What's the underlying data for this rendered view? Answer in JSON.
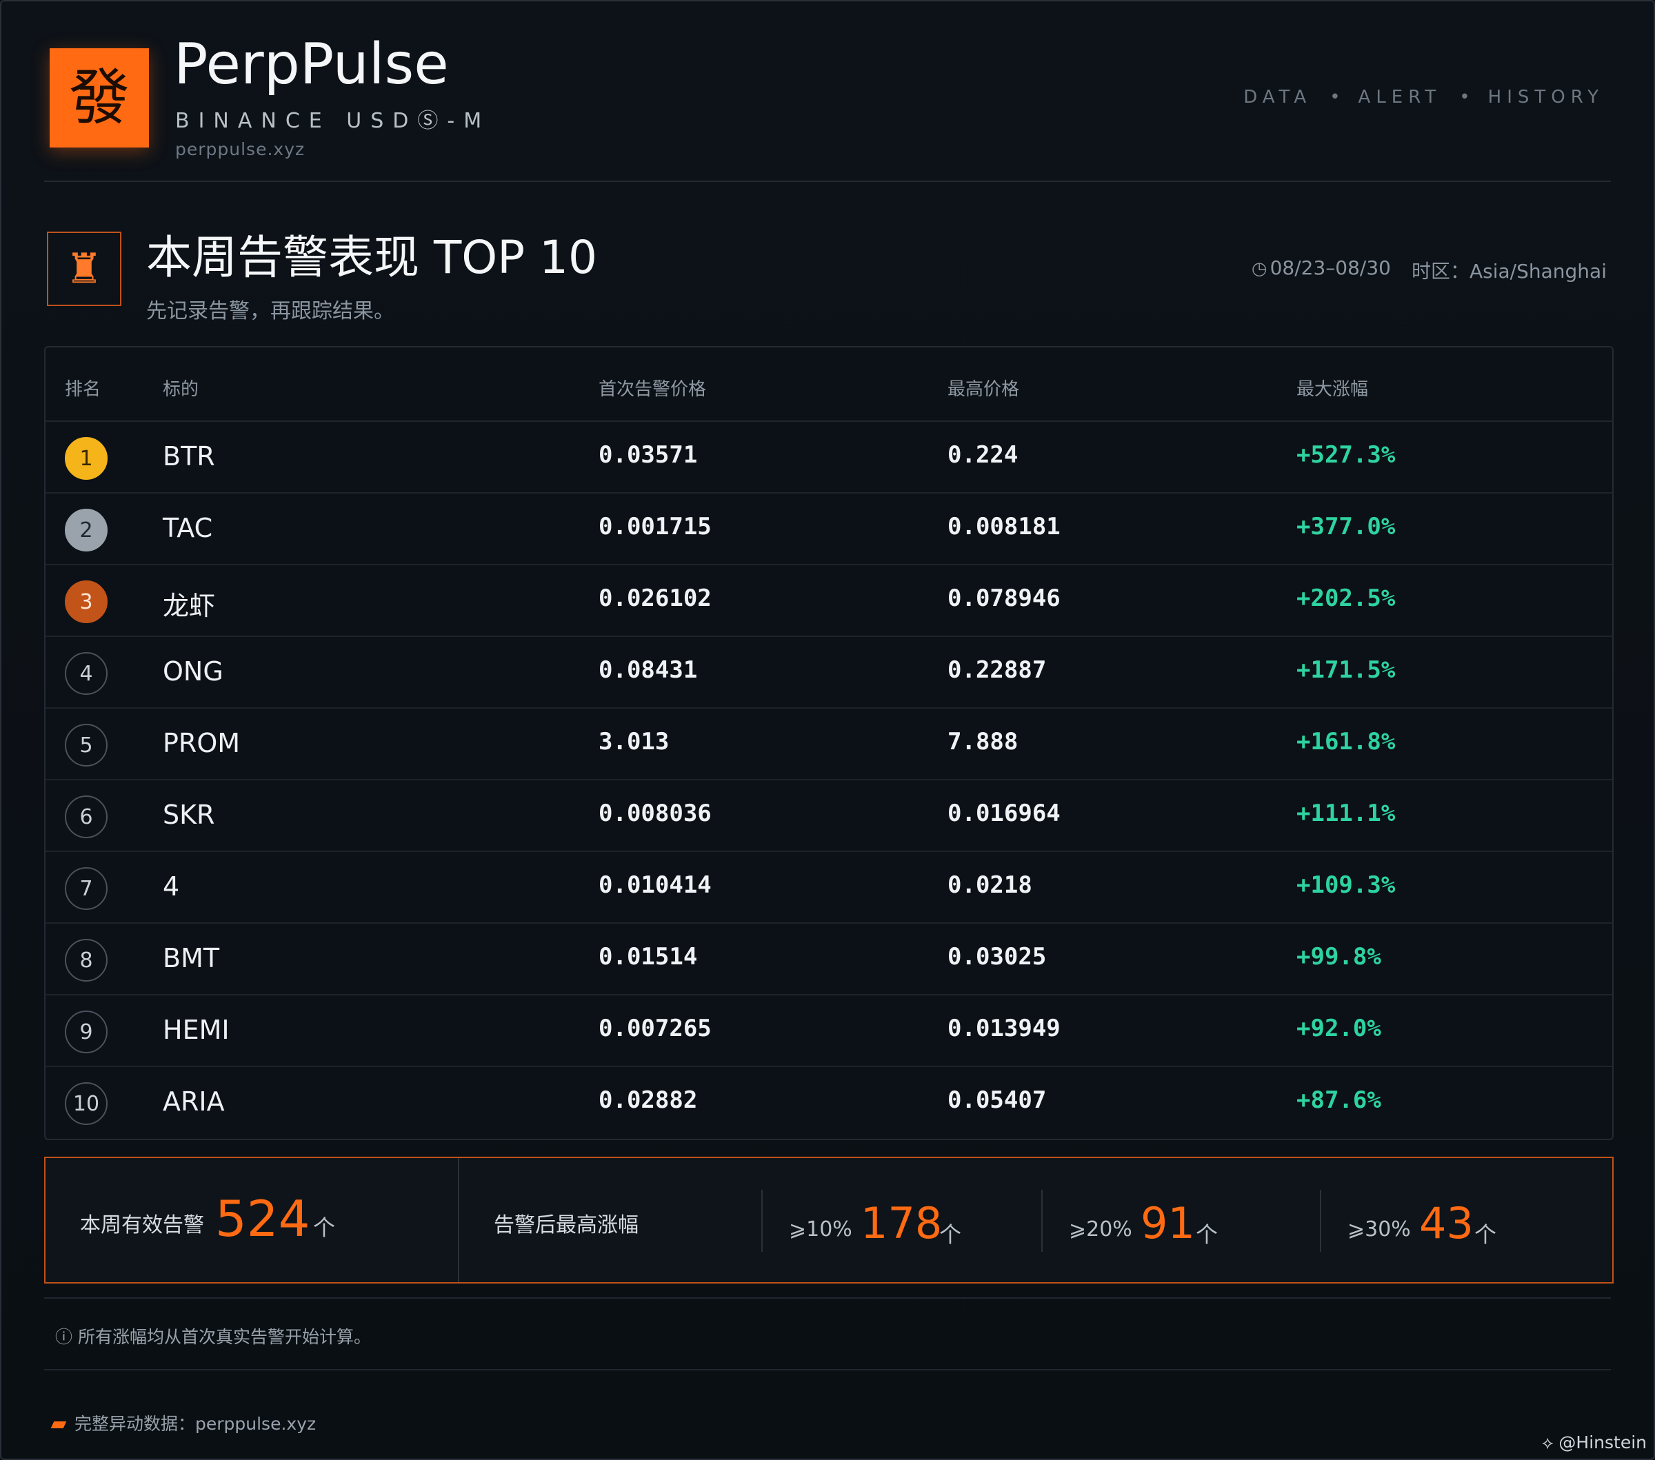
{
  "brand": {
    "logo_glyph": "發",
    "name": "PerpPulse",
    "subtitle": "BINANCE USDⓈ-M",
    "url": "perppulse.xyz",
    "accent": "#ff6a13"
  },
  "nav": {
    "items": [
      "DATA",
      "ALERT",
      "HISTORY"
    ],
    "separator": "•"
  },
  "section": {
    "icon": "chess-rook-icon",
    "title": "本周告警表现 TOP 10",
    "description": "先记录告警，再跟踪结果。",
    "date_range": "08/23–08/30",
    "timezone": "时区：Asia/Shanghai"
  },
  "table": {
    "headers": {
      "rank": "排名",
      "symbol": "标的",
      "first_price": "首次告警价格",
      "high_price": "最高价格",
      "max_gain": "最大涨幅"
    },
    "rows": [
      {
        "rank": "1",
        "symbol": "BTR",
        "first_price": "0.03571",
        "high_price": "0.224",
        "max_gain": "+527.3%"
      },
      {
        "rank": "2",
        "symbol": "TAC",
        "first_price": "0.001715",
        "high_price": "0.008181",
        "max_gain": "+377.0%"
      },
      {
        "rank": "3",
        "symbol": "龙虾",
        "first_price": "0.026102",
        "high_price": "0.078946",
        "max_gain": "+202.5%"
      },
      {
        "rank": "4",
        "symbol": "ONG",
        "first_price": "0.08431",
        "high_price": "0.22887",
        "max_gain": "+171.5%"
      },
      {
        "rank": "5",
        "symbol": "PROM",
        "first_price": "3.013",
        "high_price": "7.888",
        "max_gain": "+161.8%"
      },
      {
        "rank": "6",
        "symbol": "SKR",
        "first_price": "0.008036",
        "high_price": "0.016964",
        "max_gain": "+111.1%"
      },
      {
        "rank": "7",
        "symbol": "4",
        "first_price": "0.010414",
        "high_price": "0.0218",
        "max_gain": "+109.3%"
      },
      {
        "rank": "8",
        "symbol": "BMT",
        "first_price": "0.01514",
        "high_price": "0.03025",
        "max_gain": "+99.8%"
      },
      {
        "rank": "9",
        "symbol": "HEMI",
        "first_price": "0.007265",
        "high_price": "0.013949",
        "max_gain": "+92.0%"
      },
      {
        "rank": "10",
        "symbol": "ARIA",
        "first_price": "0.02882",
        "high_price": "0.05407",
        "max_gain": "+87.6%"
      }
    ],
    "gain_color": "#2ed3a0"
  },
  "stats": {
    "valid_label": "本周有效告警",
    "valid_count": "524",
    "unit": "个",
    "after_label": "告警后最高涨幅",
    "buckets": [
      {
        "label": "⩾10%",
        "value": "178"
      },
      {
        "label": "⩾20%",
        "value": "91"
      },
      {
        "label": "⩾30%",
        "value": "43"
      }
    ]
  },
  "note": "ⓘ 所有涨幅均从首次真实告警开始计算。",
  "footer": {
    "text": "完整异动数据：perppulse.xyz"
  },
  "credit": "⟡ @Hinstein"
}
